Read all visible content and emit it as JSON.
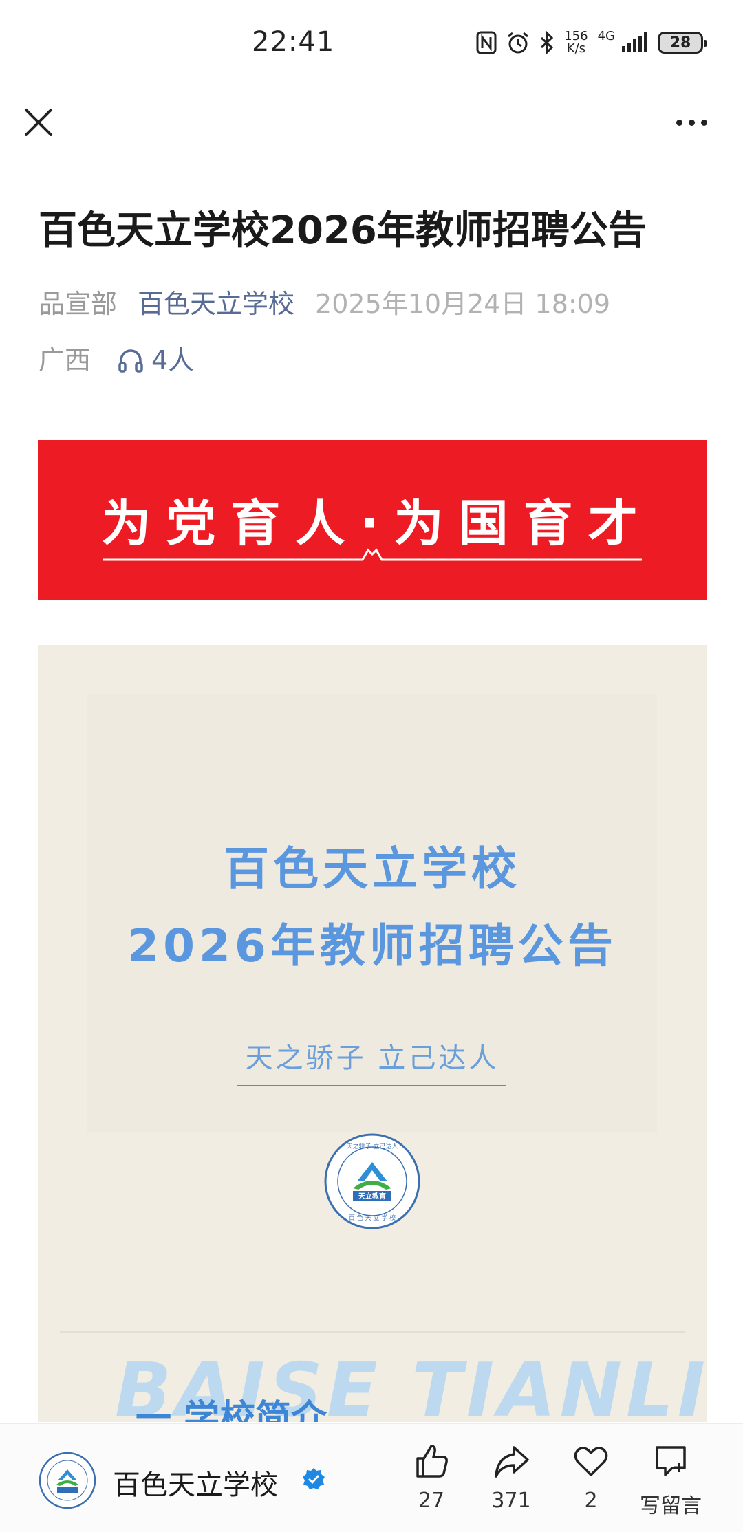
{
  "status_bar": {
    "time": "22:41",
    "net_speed_value": "156",
    "net_speed_unit": "K/s",
    "network_type": "4G",
    "battery_level": "28",
    "icons": [
      "nfc-icon",
      "alarm-icon",
      "bluetooth-icon",
      "signal-icon",
      "battery-icon"
    ]
  },
  "nav": {
    "close_icon": "close-icon",
    "more_icon": "more-icon"
  },
  "article": {
    "title": "百色天立学校2026年教师招聘公告",
    "author": "品宣部",
    "account": "百色天立学校",
    "date": "2025年10月24日 18:09",
    "region": "广西",
    "listeners": "4人"
  },
  "banner": {
    "text": "为党育人·为国育才",
    "background_color": "#ed1c24"
  },
  "poster": {
    "title_line1": "百色天立学校",
    "title_line2": "2026年教师招聘公告",
    "slogan": "天之骄子  立己达人",
    "logo_text": "天立教育",
    "logo_ring_top": "天之骄子 立己达人",
    "logo_ring_bottom": "百 色 天 立 学 校",
    "bg_text": "BAISE TIANLI",
    "section_heading": "一  学校简介",
    "accent_color": "#5b97de"
  },
  "bottom_bar": {
    "account_name": "百色天立学校",
    "like_count": "27",
    "share_count": "371",
    "favorite_count": "2",
    "comment_label": "写留言"
  }
}
